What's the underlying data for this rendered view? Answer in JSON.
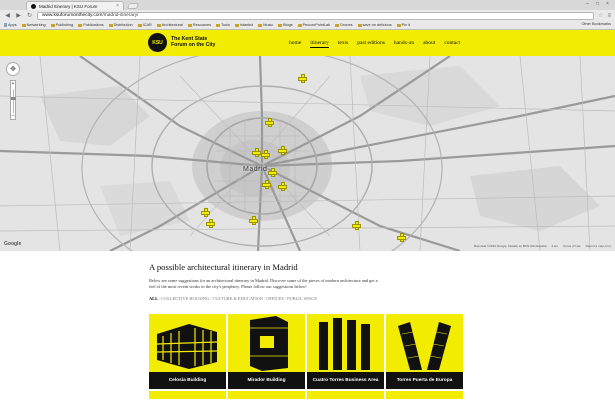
{
  "browser": {
    "tab_title": "Madrid Itinerary | KSU Forum",
    "url_host": "www.ksuforumonthecity.com",
    "url_path": "/madrid-itinerary/",
    "bookmarks": [
      "Apps",
      "Networking",
      "Publishing",
      "Publications",
      "Distribution",
      "ICAR",
      "Architectural",
      "Resources",
      "Tools",
      "Istanbul",
      "Music",
      "Blogs",
      "PecconPointLab",
      "Drones",
      "save on delicious",
      "Pin it"
    ],
    "other_bookmarks": "Other Bookmarks"
  },
  "site": {
    "logo_text": "KSU",
    "title_line1": "The Kent State",
    "title_line2": "Forum on the City",
    "nav": [
      "home",
      "itinerary",
      "texts",
      "past editions",
      "hands-on",
      "about",
      "contact"
    ],
    "active_nav": "itinerary"
  },
  "map": {
    "city_label": "Madrid",
    "google_label": "Google",
    "attribution": "Map data ©2013 Google, basado en BCN IGN España",
    "scale": "2 km",
    "terms": "Terms of Use",
    "report": "Report a map error"
  },
  "content": {
    "heading": "A possible architectural itinerary in Madrid",
    "intro": "Below are some suggestions for an architectural itinerary in Madrid. Discover some of the pieces of modern architecture and get a feel of the most recent works in the city's periphery. Please follow our suggestions below!",
    "filters": [
      "ALL",
      "COLLECTIVE HOUSING",
      "CULTURE & EDUCATION",
      "OFFICES",
      "PUBLIC SPACE"
    ]
  },
  "buildings": [
    {
      "name": "Celosía Building",
      "icon": "celosia-building-icon"
    },
    {
      "name": "Mirador Building",
      "icon": "mirador-building-icon"
    },
    {
      "name": "Cuatro Torres Business Area",
      "icon": "cuatro-torres-icon"
    },
    {
      "name": "Torres Puerta de Europa",
      "icon": "puerta-europa-icon"
    }
  ],
  "colors": {
    "accent_yellow": "#f2ec00",
    "label_black": "#111111"
  }
}
